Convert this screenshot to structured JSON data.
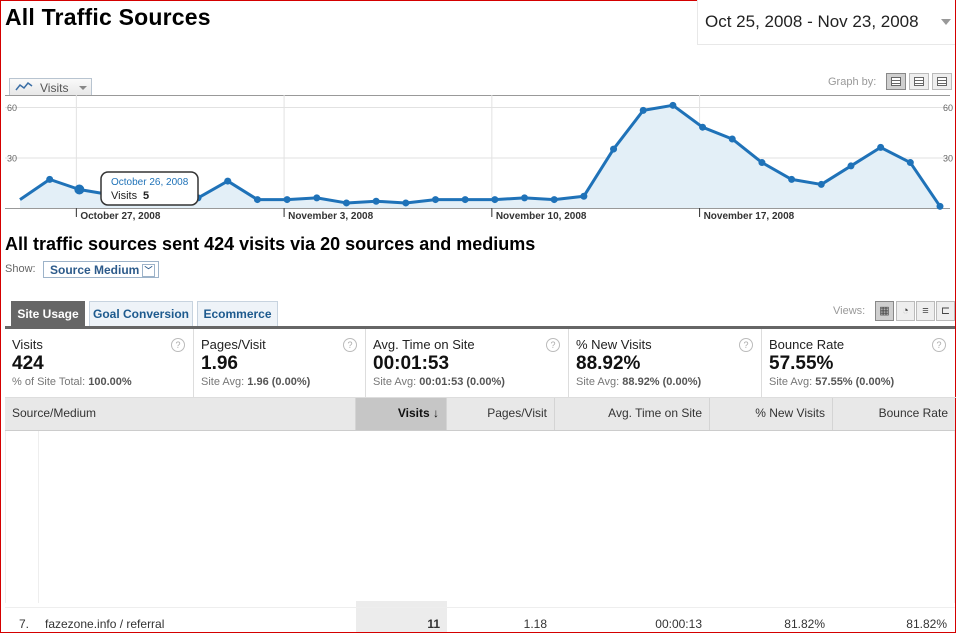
{
  "page_title": "All Traffic Sources",
  "date_range": "Oct 25, 2008 - Nov 23, 2008",
  "metric_selector": {
    "label": "Visits",
    "icon": "line-chart-icon"
  },
  "graph_by": {
    "label": "Graph by:",
    "options": [
      "day-icon",
      "week-icon",
      "month-icon"
    ]
  },
  "chart_data": {
    "type": "area",
    "series": [
      {
        "name": "Visits",
        "values": [
          5,
          17,
          11,
          8,
          6,
          4,
          6,
          16,
          5,
          5,
          6,
          3,
          4,
          3,
          5,
          5,
          5,
          6,
          5,
          7,
          35,
          58,
          61,
          48,
          41,
          27,
          17,
          14,
          25,
          36,
          27,
          1
        ]
      }
    ],
    "ylim": [
      0,
      60
    ],
    "yticks_left": [
      "60",
      "30"
    ],
    "yticks_right": [
      "60",
      "30"
    ],
    "xticks": [
      "October 27, 2008",
      "November 3, 2008",
      "November 10, 2008",
      "November 17, 2008"
    ],
    "tooltip": {
      "date": "October 26, 2008",
      "label": "Visits",
      "value": "5"
    },
    "grid": true,
    "colors": {
      "line": "#1f72b8",
      "fill": "#e3eff7"
    }
  },
  "summary_text": "All traffic sources sent 424 visits via 20 sources and mediums",
  "show": {
    "label": "Show:",
    "selected": "Source Medium"
  },
  "tabs": [
    {
      "label": "Site Usage",
      "active": true
    },
    {
      "label": "Goal Conversion",
      "active": false
    },
    {
      "label": "Ecommerce",
      "active": false
    }
  ],
  "views_label": "Views:",
  "scorecard": [
    {
      "name": "Visits",
      "value": "424",
      "sub_prefix": "% of Site Total:",
      "sub_value": "100.00%"
    },
    {
      "name": "Pages/Visit",
      "value": "1.96",
      "sub_prefix": "Site Avg:",
      "sub_value": "1.96 (0.00%)"
    },
    {
      "name": "Avg. Time on Site",
      "value": "00:01:53",
      "sub_prefix": "Site Avg:",
      "sub_value": "00:01:53 (0.00%)"
    },
    {
      "name": "% New Visits",
      "value": "88.92%",
      "sub_prefix": "Site Avg:",
      "sub_value": "88.92% (0.00%)"
    },
    {
      "name": "Bounce Rate",
      "value": "57.55%",
      "sub_prefix": "Site Avg:",
      "sub_value": "57.55% (0.00%)"
    }
  ],
  "table": {
    "headers": [
      "Source/Medium",
      "Visits",
      "Pages/Visit",
      "Avg. Time on Site",
      "% New Visits",
      "Bounce Rate"
    ],
    "sort_indicator": "↓",
    "rows": [
      {
        "index": "7.",
        "source": "fazezone.info / referral",
        "visits": "11",
        "pages": "1.18",
        "time": "00:00:13",
        "new": "81.82%",
        "bounce": "81.82%"
      }
    ]
  }
}
